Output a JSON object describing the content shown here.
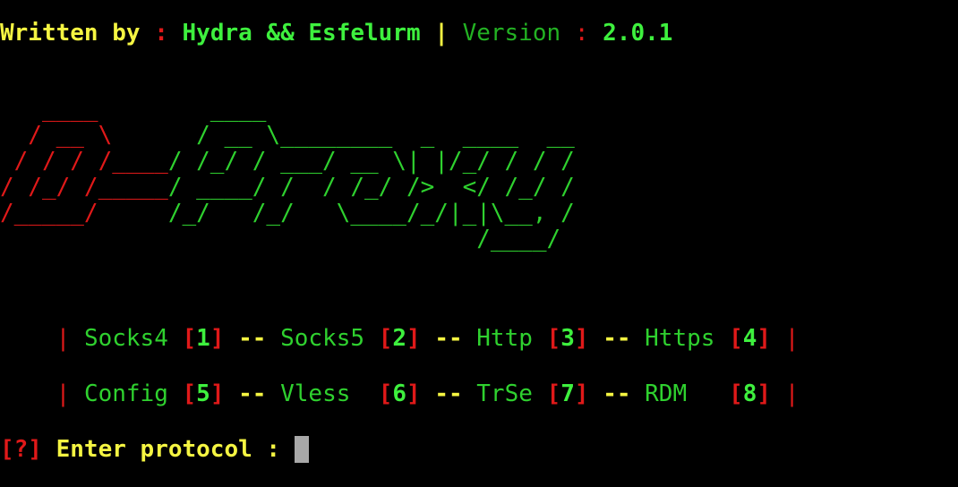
{
  "header": {
    "written_by_label": "Written by",
    "sep1": " : ",
    "authors": "Hydra && Esfelurm",
    "pipe": " | ",
    "version_label": "Version",
    "sep2": " : ",
    "version": "2.0.1"
  },
  "banner": {
    "rows": [
      {
        "red": "   ____",
        "green": "        ____"
      },
      {
        "red": "  / __ \\",
        "green": "      / __ \\________  _  ____  __"
      },
      {
        "red": " / / / /____",
        "green": "/ /_/ / ___/ __ \\| |/_/ / / /"
      },
      {
        "red": "/ /_/ /_____",
        "green": "/ ____/ /  / /_/ />  </ /_/ /"
      },
      {
        "red": "/_____/",
        "green": "     /_/   /_/   \\____/_/|_|\\__, /"
      },
      {
        "red": "",
        "green": "                                  /____/"
      }
    ]
  },
  "menu": {
    "row1": [
      {
        "name": "Socks4",
        "num": "1"
      },
      {
        "name": "Socks5",
        "num": "2"
      },
      {
        "name": "Http",
        "num": "3"
      },
      {
        "name": "Https",
        "num": "4"
      }
    ],
    "row2": [
      {
        "name": "Config",
        "num": "5"
      },
      {
        "name": "Vless ",
        "num": "6"
      },
      {
        "name": "TrSe",
        "num": "7"
      },
      {
        "name": "RDM  ",
        "num": "8"
      }
    ],
    "pipe": "|",
    "separator": "--",
    "bracket_open": "[",
    "bracket_close": "]"
  },
  "prompt": {
    "marker": "[?]",
    "text": "Enter protocol : "
  },
  "colors": {
    "background": "#000000",
    "yellow": "#f5f542",
    "green": "#2fd12f",
    "red": "#e01919",
    "cursor": "#a8a8a8"
  }
}
